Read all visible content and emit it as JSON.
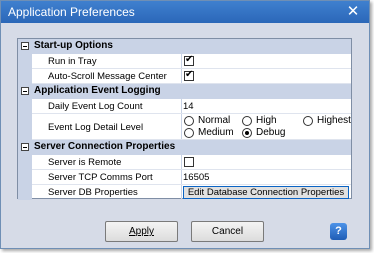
{
  "window": {
    "title": "Application Preferences",
    "close_glyph": "✕"
  },
  "sections": {
    "startup": {
      "title": "Start-up Options",
      "run_in_tray": "Run in Tray",
      "auto_scroll": "Auto-Scroll Message Center"
    },
    "logging": {
      "title": "Application Event Logging",
      "daily_count_label": "Daily Event Log Count",
      "daily_count_value": "14",
      "detail_level_label": "Event Log Detail Level",
      "options": {
        "normal": "Normal",
        "high": "High",
        "highest": "Highest",
        "medium": "Medium",
        "debug": "Debug"
      }
    },
    "server": {
      "title": "Server Connection Properties",
      "is_remote": "Server is Remote",
      "tcp_port_label": "Server TCP Comms Port",
      "tcp_port_value": "16505",
      "db_props_label": "Server DB Properties",
      "edit_db_button": "Edit Database Connection Properties"
    }
  },
  "checks": {
    "run_in_tray": true,
    "auto_scroll": true,
    "is_remote": false
  },
  "selected_detail_level": "Debug",
  "buttons": {
    "apply": "Apply",
    "cancel": "Cancel",
    "help": "?"
  }
}
